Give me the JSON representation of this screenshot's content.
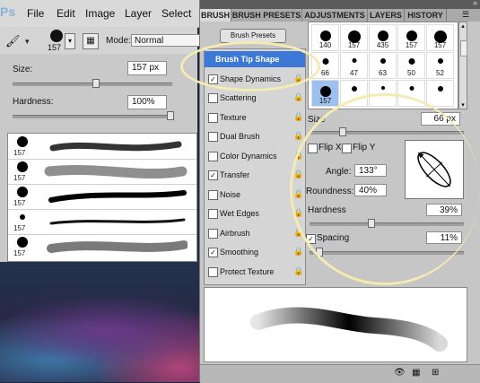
{
  "menubar": {
    "logo": "Ps",
    "items": [
      "File",
      "Edit",
      "Image",
      "Layer",
      "Select"
    ]
  },
  "options_bar": {
    "brush_size": "157",
    "mode_label": "Mode:",
    "mode_value": "Normal"
  },
  "brush_popup": {
    "size_label": "Size:",
    "size_value": "157 px",
    "size_level": 0.52,
    "hardness_label": "Hardness:",
    "hardness_value": "100%",
    "hardness_level": 1.0,
    "presets": [
      {
        "size": "157"
      },
      {
        "size": "157"
      },
      {
        "size": "157"
      },
      {
        "size": "157"
      },
      {
        "size": "157"
      }
    ]
  },
  "panel": {
    "tabs": [
      "BRUSH",
      "BRUSH PRESETS",
      "ADJUSTMENTS",
      "LAYERS",
      "HISTORY"
    ],
    "presets_button": "Brush Presets",
    "options": [
      {
        "label": "Brush Tip Shape",
        "checked": null,
        "selected": true
      },
      {
        "label": "Shape Dynamics",
        "checked": true
      },
      {
        "label": "Scattering",
        "checked": false
      },
      {
        "label": "Texture",
        "checked": false
      },
      {
        "label": "Dual Brush",
        "checked": false
      },
      {
        "label": "Color Dynamics",
        "checked": false
      },
      {
        "label": "Transfer",
        "checked": true
      },
      {
        "label": "Noise",
        "checked": false
      },
      {
        "label": "Wet Edges",
        "checked": false
      },
      {
        "label": "Airbrush",
        "checked": false
      },
      {
        "label": "Smoothing",
        "checked": true
      },
      {
        "label": "Protect Texture",
        "checked": false
      }
    ],
    "tips": [
      "140",
      "157",
      "435",
      "157",
      "157",
      "66",
      "47",
      "63",
      "50",
      "52",
      "157",
      "",
      "",
      "",
      ""
    ],
    "size_label": "Size",
    "size_value": "66 px",
    "size_level": 0.2,
    "flip_x": "Flip X",
    "flip_y": "Flip Y",
    "angle_label": "Angle:",
    "angle_value": "133°",
    "roundness_label": "Roundness:",
    "roundness_value": "40%",
    "hardness_label": "Hardness",
    "hardness_value": "39%",
    "hardness_level": 0.39,
    "spacing_label": "Spacing",
    "spacing_value": "11%",
    "spacing_checked": true,
    "spacing_level": 0.04
  }
}
